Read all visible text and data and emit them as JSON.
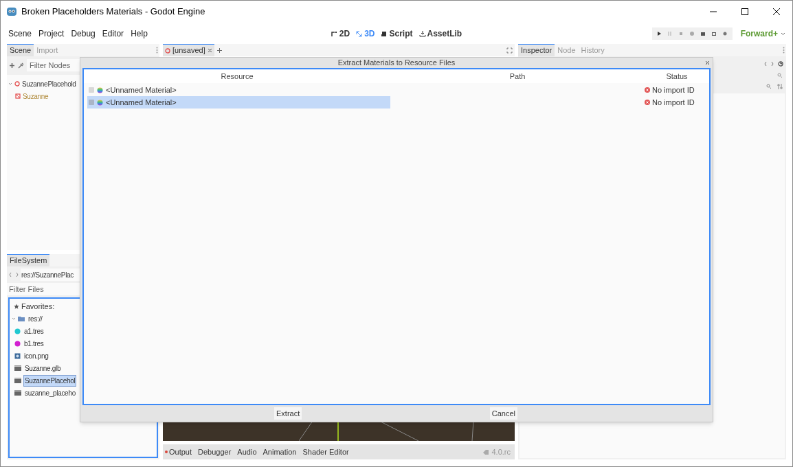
{
  "window": {
    "title": "Broken Placeholders Materials - Godot Engine"
  },
  "menu": [
    "Scene",
    "Project",
    "Debug",
    "Editor",
    "Help"
  ],
  "main_screens": [
    {
      "label": "2D",
      "kind": "planar",
      "selected": false
    },
    {
      "label": "3D",
      "kind": "spatial",
      "selected": true
    },
    {
      "label": "Script",
      "kind": "script",
      "selected": false
    },
    {
      "label": "AssetLib",
      "kind": "assetlib",
      "selected": false
    }
  ],
  "renderer": "Forward+",
  "scene_dock": {
    "tabs": [
      {
        "label": "Scene",
        "selected": true
      },
      {
        "label": "Import",
        "selected": false
      }
    ],
    "filter_placeholder": "Filter Nodes",
    "tree": [
      {
        "label": "SuzannePlacehold",
        "kind": "root",
        "expanded": true,
        "children": [
          {
            "label": "Suzanne",
            "kind": "mesh"
          }
        ]
      }
    ]
  },
  "filesystem": {
    "tabs": [
      {
        "label": "FileSystem",
        "selected": true
      }
    ],
    "path": "res://SuzannePlac",
    "filter_placeholder": "Filter Files",
    "favorites": "Favorites:",
    "tree": [
      {
        "label": "res://",
        "kind": "folder",
        "expanded": true,
        "selected": false,
        "children": [
          {
            "label": "a1.tres",
            "kind": "material",
            "color": "#1fc8d0",
            "selected": false
          },
          {
            "label": "b1.tres",
            "kind": "material",
            "color": "#d21fd0",
            "selected": false
          },
          {
            "label": "icon.png",
            "kind": "image",
            "selected": false
          },
          {
            "label": "Suzanne.glb",
            "kind": "scene",
            "selected": false
          },
          {
            "label": "SuzannePlacehol",
            "kind": "scene",
            "selected": true
          },
          {
            "label": "suzanne_placeho",
            "kind": "scene",
            "selected": false
          }
        ]
      }
    ]
  },
  "editor_tabs": [
    {
      "label": "[unsaved]",
      "selected": true
    }
  ],
  "bottom_panel": {
    "tabs": [
      {
        "label": "Output",
        "alert": true
      },
      {
        "label": "Debugger",
        "alert": false
      },
      {
        "label": "Audio",
        "alert": false
      },
      {
        "label": "Animation",
        "alert": false
      },
      {
        "label": "Shader Editor",
        "alert": false
      }
    ],
    "version": "4.0.rc"
  },
  "inspector_dock": {
    "tabs": [
      {
        "label": "Inspector",
        "selected": true
      },
      {
        "label": "Node",
        "selected": false
      },
      {
        "label": "History",
        "selected": false
      }
    ]
  },
  "dialog": {
    "title": "Extract Materials to Resource Files",
    "columns": [
      "Resource",
      "Path",
      "Status"
    ],
    "rows": [
      {
        "resource": "<Unnamed Material>",
        "checked": false,
        "selected": false,
        "status": "No import ID"
      },
      {
        "resource": "<Unnamed Material>",
        "checked": false,
        "selected": true,
        "status": "No import ID"
      }
    ],
    "buttons": [
      "Extract",
      "Cancel"
    ]
  }
}
